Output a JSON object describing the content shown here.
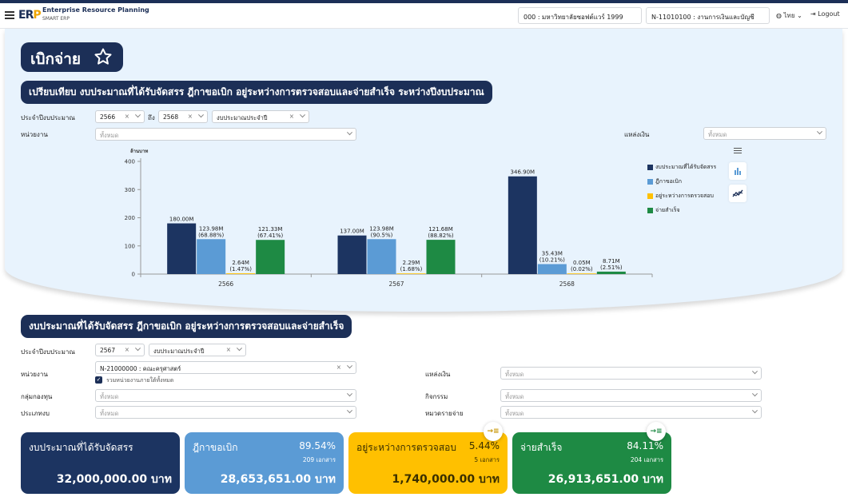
{
  "app": {
    "title": "Enterprise Resource Planning",
    "subtitle": "SMART ERP",
    "logo": "ERP"
  },
  "header": {
    "org": "000 : มหาวิทยาลัยซอฟต์แวร์ 1999",
    "unit": "N-11010100 : งานการเงินและบัญชี",
    "language": "ไทย",
    "logout": "Logout"
  },
  "page": {
    "title": "เบิกจ่าย"
  },
  "section1": {
    "title": "เปรียบเทียบ งบประมาณที่ได้รับจัดสรร ฎีกาขอเบิก อยู่ระหว่างการตรวจสอบและจ่ายสำเร็จ ระหว่างปีงบประมาณ",
    "fiscal_label": "ประจำปีงบประมาณ",
    "year_from": "2566",
    "to_label": "ถึง",
    "year_to": "2568",
    "budget_type": "งบประมาณประจำปี",
    "dept_label": "หน่วยงาน",
    "dept_placeholder": "ทั้งหมด",
    "source_label": "แหล่งเงิน",
    "source_placeholder": "ทั้งหมด"
  },
  "chart_data": {
    "type": "bar",
    "ylabel": "ล้านบาท",
    "ylim": [
      0,
      400
    ],
    "yticks": [
      "0",
      "100",
      "200",
      "300",
      "400"
    ],
    "categories": [
      "2566",
      "2567",
      "2568"
    ],
    "series": [
      {
        "name": "งบประมาณที่ได้รับจัดสรร",
        "color": "#1c3461",
        "values": [
          180.0,
          137.0,
          346.9
        ],
        "labels": [
          "180.00M",
          "137.00M",
          "346.90M"
        ]
      },
      {
        "name": "ฎีกาขอเบิก",
        "color": "#5b9bd5",
        "values": [
          123.98,
          123.98,
          35.43
        ],
        "labels": [
          "123.98M\n(68.88%)",
          "123.98M\n(90.5%)",
          "35.43M\n(10.21%)"
        ]
      },
      {
        "name": "อยู่ระหว่างการตรวจสอบ",
        "color": "#ffc000",
        "values": [
          2.64,
          2.29,
          0.05
        ],
        "labels": [
          "2.64M\n(1.47%)",
          "2.29M\n(1.68%)",
          "0.05M\n(0.02%)"
        ]
      },
      {
        "name": "จ่ายสำเร็จ",
        "color": "#1e8a44",
        "values": [
          121.33,
          121.68,
          8.71
        ],
        "labels": [
          "121.33M\n(67.41%)",
          "121.68M\n(88.82%)",
          "8.71M\n(2.51%)"
        ]
      }
    ],
    "legend": "right"
  },
  "section2": {
    "title": "งบประมาณที่ได้รับจัดสรร ฎีกาขอเบิก อยู่ระหว่างการตรวจสอบและจ่ายสำเร็จ",
    "fiscal_label": "ประจำปีงบประมาณ",
    "year": "2567",
    "budget_type": "งบประมาณประจำปี",
    "dept_label": "หน่วยงาน",
    "dept_value": "N-21000000 : คณะครุศาสตร์",
    "include_sub": "รวมหน่วยงานภายใต้ทั้งหมด",
    "source_label": "แหล่งเงิน",
    "fund_group_label": "กลุ่มกองทุน",
    "activity_label": "กิจกรรม",
    "type_label": "ประเภทงบ",
    "expense_label": "หมวดรายจ่าย",
    "placeholder": "ทั้งหมด"
  },
  "cards": [
    {
      "title": "งบประมาณที่ได้รับจัดสรร",
      "amount": "32,000,000.00 บาท",
      "color": "#1c3461"
    },
    {
      "title": "ฎีกาขอเบิก",
      "percent": "89.54%",
      "docs": "209 เอกสาร",
      "amount": "28,653,651.00 บาท",
      "color": "#5b9bd5"
    },
    {
      "title": "อยู่ระหว่างการตรวจสอบ",
      "percent": "5.44%",
      "docs": "5 เอกสาร",
      "amount": "1,740,000.00 บาท",
      "color": "#ffc000"
    },
    {
      "title": "จ่ายสำเร็จ",
      "percent": "84.11%",
      "docs": "204 เอกสาร",
      "amount": "26,913,651.00 บาท",
      "color": "#1e8a44"
    }
  ]
}
